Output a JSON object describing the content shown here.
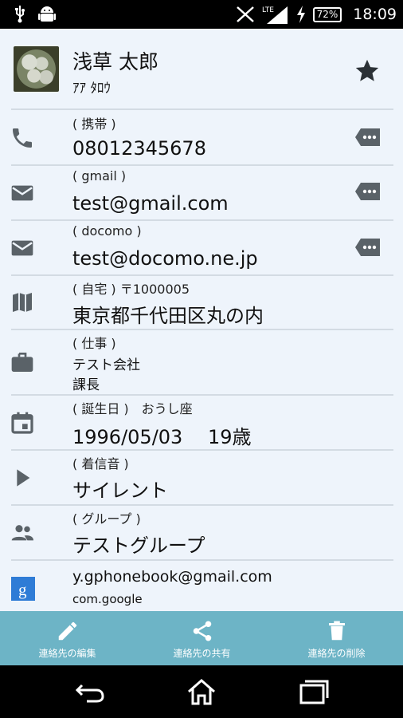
{
  "status_bar": {
    "left_icons": [
      "usb-icon",
      "android-icon"
    ],
    "right_icons": [
      "no-signal-icon",
      "lte-signal-icon",
      "charging-icon"
    ],
    "network": "LTE",
    "battery": "72%",
    "time": "18:09"
  },
  "contact": {
    "name": "浅草 太郎",
    "kana": "ｱｱ ﾀﾛｳ",
    "starred": true
  },
  "details": [
    {
      "icon": "phone-icon",
      "label": "( 携帯 )",
      "value": "08012345678",
      "message": true
    },
    {
      "icon": "email-icon",
      "label": "( gmail )",
      "value": "test@gmail.com",
      "message": true
    },
    {
      "icon": "email-icon",
      "label": "( docomo )",
      "value": "test@docomo.ne.jp",
      "message": true
    },
    {
      "icon": "map-icon",
      "label": "( 自宅 ) 〒1000005",
      "value": "東京都千代田区丸の内",
      "message": false
    },
    {
      "icon": "briefcase-icon",
      "label": "( 仕事 )",
      "line1": "テスト会社",
      "line2": "課長",
      "message": false
    },
    {
      "icon": "calendar-icon",
      "label": "( 誕生日 )　おうし座",
      "value": "1996/05/03　 19歳",
      "message": false
    },
    {
      "icon": "play-icon",
      "label": "( 着信音 )",
      "value": "サイレント",
      "message": false
    },
    {
      "icon": "group-icon",
      "label": "( グループ )",
      "value": "テストグループ",
      "message": false
    },
    {
      "icon": "google-icon",
      "value": "y.gphonebook@gmail.com",
      "sub": "com.google",
      "message": false
    }
  ],
  "actions": [
    {
      "icon": "pencil-icon",
      "label": "連絡先の編集"
    },
    {
      "icon": "share-icon",
      "label": "連絡先の共有"
    },
    {
      "icon": "trash-icon",
      "label": "連絡先の削除"
    }
  ],
  "nav": [
    "back-icon",
    "home-icon",
    "recents-icon"
  ],
  "colors": {
    "background": "#eef4fb",
    "action_bar": "#6db4c6",
    "icon_gray": "#5a6268",
    "divider": "#d3dbe3"
  }
}
